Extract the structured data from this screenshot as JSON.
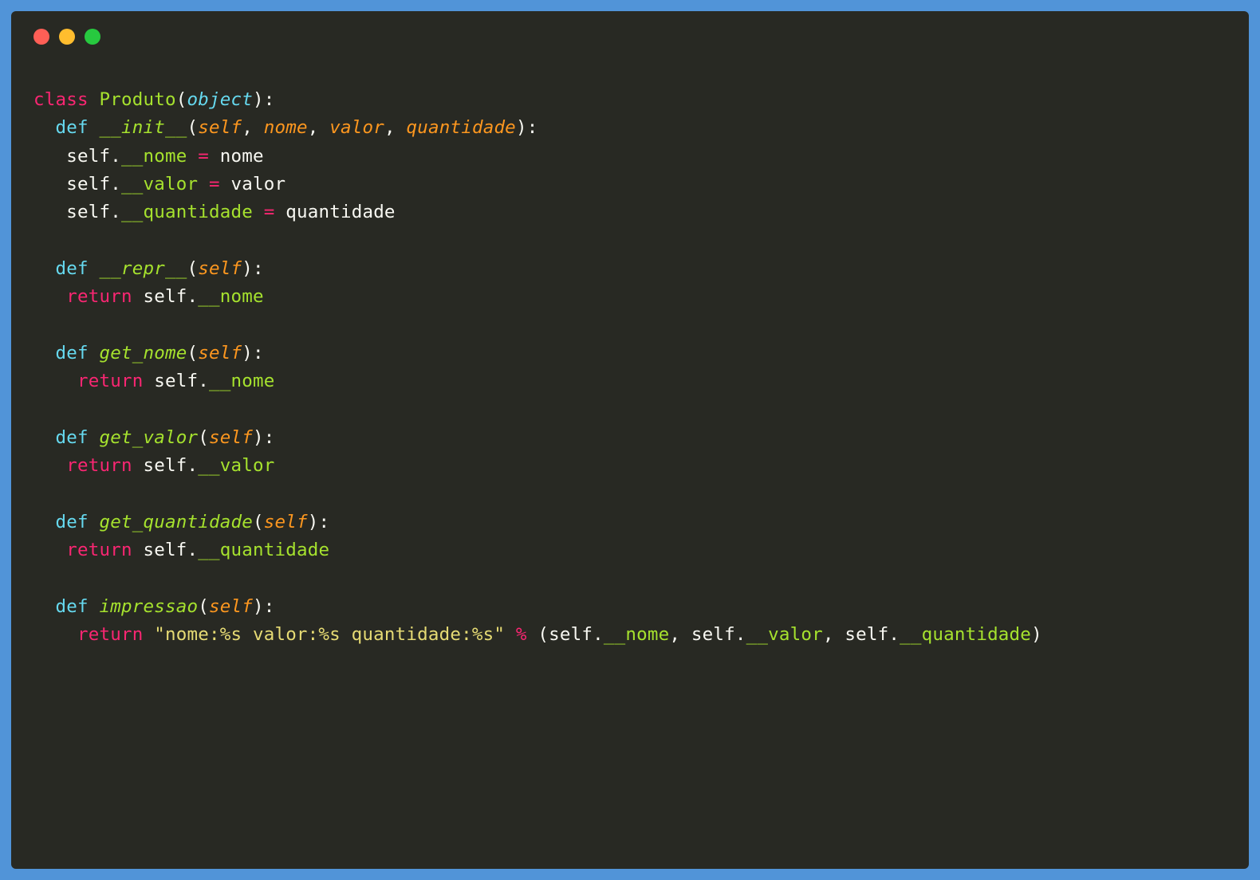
{
  "colors": {
    "frame": "#5194d8",
    "background": "#282923",
    "default_text": "#f8f8f2",
    "keyword": "#f92672",
    "storage": "#66d9ef",
    "class_name": "#a6e22e",
    "function_name": "#a6e22e",
    "attribute": "#a6e22e",
    "param": "#fd971f",
    "string": "#e6db74",
    "traffic_red": "#ff5f56",
    "traffic_yellow": "#ffbd2e",
    "traffic_green": "#27c93f"
  },
  "tokens": {
    "kw_class": "class",
    "kw_def": "def",
    "kw_return": "return",
    "cls_produto": "Produto",
    "builtin_object": "object",
    "fn_init": "__init__",
    "fn_repr": "__repr__",
    "fn_get_nome": "get_nome",
    "fn_get_valor": "get_valor",
    "fn_get_quantidade": "get_quantidade",
    "fn_impressao": "impressao",
    "p_self": "self",
    "p_nome": "nome",
    "p_valor": "valor",
    "p_quantidade": "quantidade",
    "attr_nome": "__nome",
    "attr_valor": "__valor",
    "attr_quantidade": "__quantidade",
    "id_nome": "nome",
    "id_valor": "valor",
    "id_quantidade": "quantidade",
    "id_self": "self",
    "str_format": "\"nome:%s valor:%s quantidade:%s\"",
    "op_percent": "%",
    "eq": "=",
    "dot": ".",
    "colon": ":",
    "comma": ",",
    "lparen": "(",
    "rparen": ")"
  }
}
